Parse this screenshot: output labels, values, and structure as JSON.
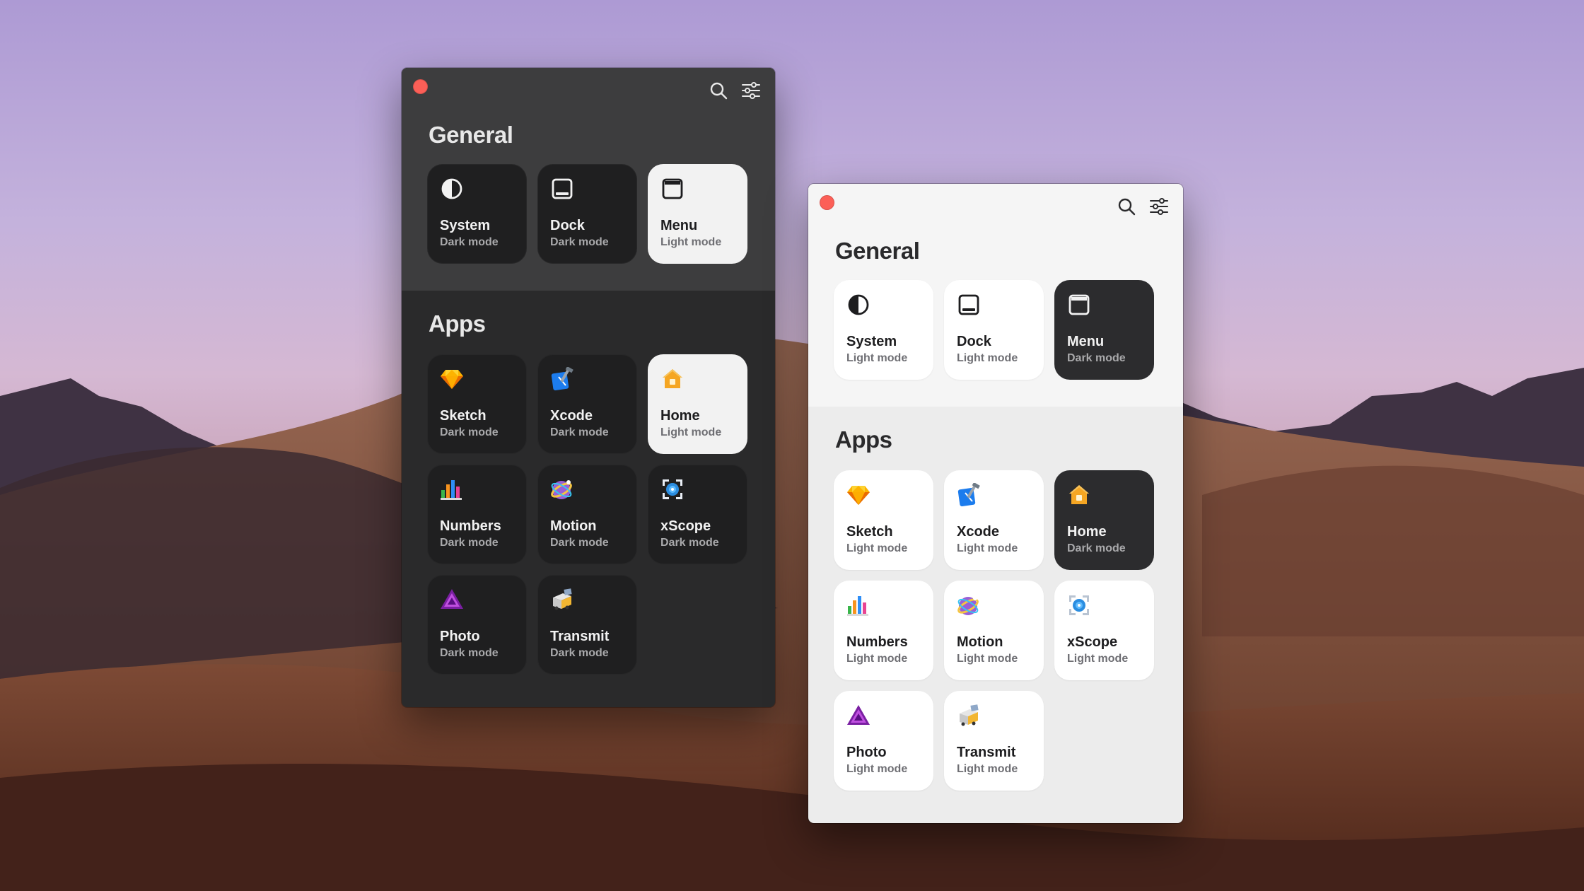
{
  "windows": [
    {
      "theme": "dark",
      "general_title": "General",
      "apps_title": "Apps",
      "general": [
        {
          "name": "System",
          "mode": "Dark mode",
          "icon": "half-circle-icon",
          "style": "dark"
        },
        {
          "name": "Dock",
          "mode": "Dark mode",
          "icon": "dock-icon",
          "style": "dark"
        },
        {
          "name": "Menu",
          "mode": "Light mode",
          "icon": "menu-bar-icon",
          "style": "light"
        }
      ],
      "apps": [
        {
          "name": "Sketch",
          "mode": "Dark mode",
          "icon": "sketch-icon",
          "style": "dark"
        },
        {
          "name": "Xcode",
          "mode": "Dark mode",
          "icon": "xcode-icon",
          "style": "dark"
        },
        {
          "name": "Home",
          "mode": "Light mode",
          "icon": "home-icon",
          "style": "light"
        },
        {
          "name": "Numbers",
          "mode": "Dark mode",
          "icon": "numbers-icon",
          "style": "dark"
        },
        {
          "name": "Motion",
          "mode": "Dark mode",
          "icon": "motion-icon",
          "style": "dark"
        },
        {
          "name": "xScope",
          "mode": "Dark mode",
          "icon": "xscope-icon",
          "style": "dark"
        },
        {
          "name": "Photo",
          "mode": "Dark mode",
          "icon": "affinity-photo-icon",
          "style": "dark"
        },
        {
          "name": "Transmit",
          "mode": "Dark mode",
          "icon": "transmit-icon",
          "style": "dark"
        }
      ]
    },
    {
      "theme": "light",
      "general_title": "General",
      "apps_title": "Apps",
      "general": [
        {
          "name": "System",
          "mode": "Light mode",
          "icon": "half-circle-icon",
          "style": "light"
        },
        {
          "name": "Dock",
          "mode": "Light mode",
          "icon": "dock-icon",
          "style": "light"
        },
        {
          "name": "Menu",
          "mode": "Dark mode",
          "icon": "menu-bar-icon",
          "style": "dark"
        }
      ],
      "apps": [
        {
          "name": "Sketch",
          "mode": "Light mode",
          "icon": "sketch-icon",
          "style": "light"
        },
        {
          "name": "Xcode",
          "mode": "Light mode",
          "icon": "xcode-icon",
          "style": "light"
        },
        {
          "name": "Home",
          "mode": "Dark mode",
          "icon": "home-icon",
          "style": "dark"
        },
        {
          "name": "Numbers",
          "mode": "Light mode",
          "icon": "numbers-icon",
          "style": "light"
        },
        {
          "name": "Motion",
          "mode": "Light mode",
          "icon": "motion-icon",
          "style": "light"
        },
        {
          "name": "xScope",
          "mode": "Light mode",
          "icon": "xscope-icon",
          "style": "light"
        },
        {
          "name": "Photo",
          "mode": "Light mode",
          "icon": "affinity-photo-icon",
          "style": "light"
        },
        {
          "name": "Transmit",
          "mode": "Light mode",
          "icon": "transmit-icon",
          "style": "light"
        }
      ]
    }
  ],
  "colors": {
    "close_button": "#fc5f57",
    "dark_panel": "#2a2a2b",
    "light_panel": "#ececec"
  }
}
